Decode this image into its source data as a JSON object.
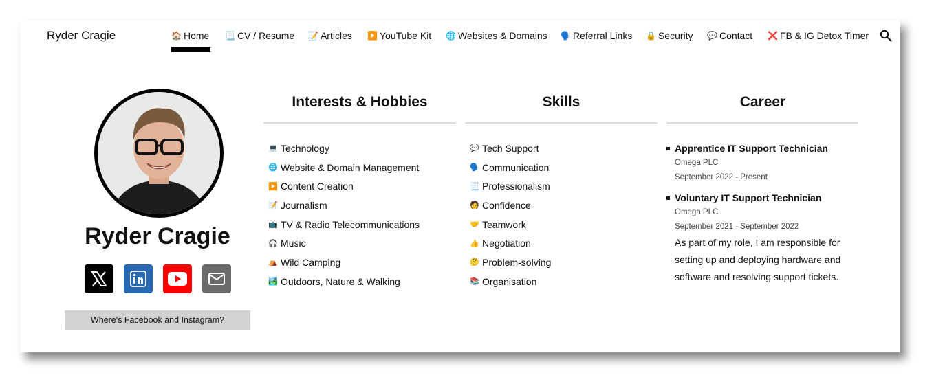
{
  "brand": "Ryder Cragie",
  "nav": [
    {
      "label": "Home",
      "icon": "🏠"
    },
    {
      "label": "CV / Resume",
      "icon": "📃"
    },
    {
      "label": "Articles",
      "icon": "📝"
    },
    {
      "label": "YouTube Kit",
      "icon": "▶️"
    },
    {
      "label": "Websites & Domains",
      "icon": "🌐"
    },
    {
      "label": "Referral Links",
      "icon": "🗣️"
    },
    {
      "label": "Security",
      "icon": "🔒"
    },
    {
      "label": "Contact",
      "icon": "💬"
    },
    {
      "label": "FB & IG Detox Timer",
      "icon": "❌"
    }
  ],
  "profile": {
    "name": "Ryder Cragie",
    "fb_ig_button": "Where's Facebook and Instagram?",
    "social": [
      "x-icon",
      "linkedin-icon",
      "youtube-icon",
      "email-icon"
    ]
  },
  "interests": {
    "title": "Interests & Hobbies",
    "items": [
      {
        "icon": "💻",
        "label": "Technology"
      },
      {
        "icon": "🌐",
        "label": "Website & Domain Management"
      },
      {
        "icon": "▶️",
        "label": "Content Creation"
      },
      {
        "icon": "📝",
        "label": "Journalism"
      },
      {
        "icon": "📺",
        "label": "TV & Radio Telecommunications"
      },
      {
        "icon": "🎧",
        "label": "Music"
      },
      {
        "icon": "⛺",
        "label": "Wild Camping"
      },
      {
        "icon": "🏞️",
        "label": "Outdoors, Nature & Walking"
      }
    ]
  },
  "skills": {
    "title": "Skills",
    "items": [
      {
        "icon": "💬",
        "label": "Tech Support"
      },
      {
        "icon": "🗣️",
        "label": "Communication"
      },
      {
        "icon": "📃",
        "label": "Professionalism"
      },
      {
        "icon": "🧑",
        "label": "Confidence"
      },
      {
        "icon": "🤝",
        "label": "Teamwork"
      },
      {
        "icon": "👍",
        "label": "Negotiation"
      },
      {
        "icon": "🤔",
        "label": "Problem-solving"
      },
      {
        "icon": "📚",
        "label": "Organisation"
      }
    ]
  },
  "career": {
    "title": "Career",
    "jobs": [
      {
        "title": "Apprentice IT Support Technician",
        "company": "Omega PLC",
        "dates": "September 2022 - Present"
      },
      {
        "title": "Voluntary IT Support Technician",
        "company": "Omega PLC",
        "dates": "September 2021 - September 2022"
      }
    ],
    "description": "As part of my role, I am responsible for setting up and deploying hardware and software and resolving support tickets."
  },
  "colors": {
    "linkedin": "#2867b2",
    "youtube": "#ff0000",
    "email": "#6b6b6b",
    "x": "#000000"
  }
}
